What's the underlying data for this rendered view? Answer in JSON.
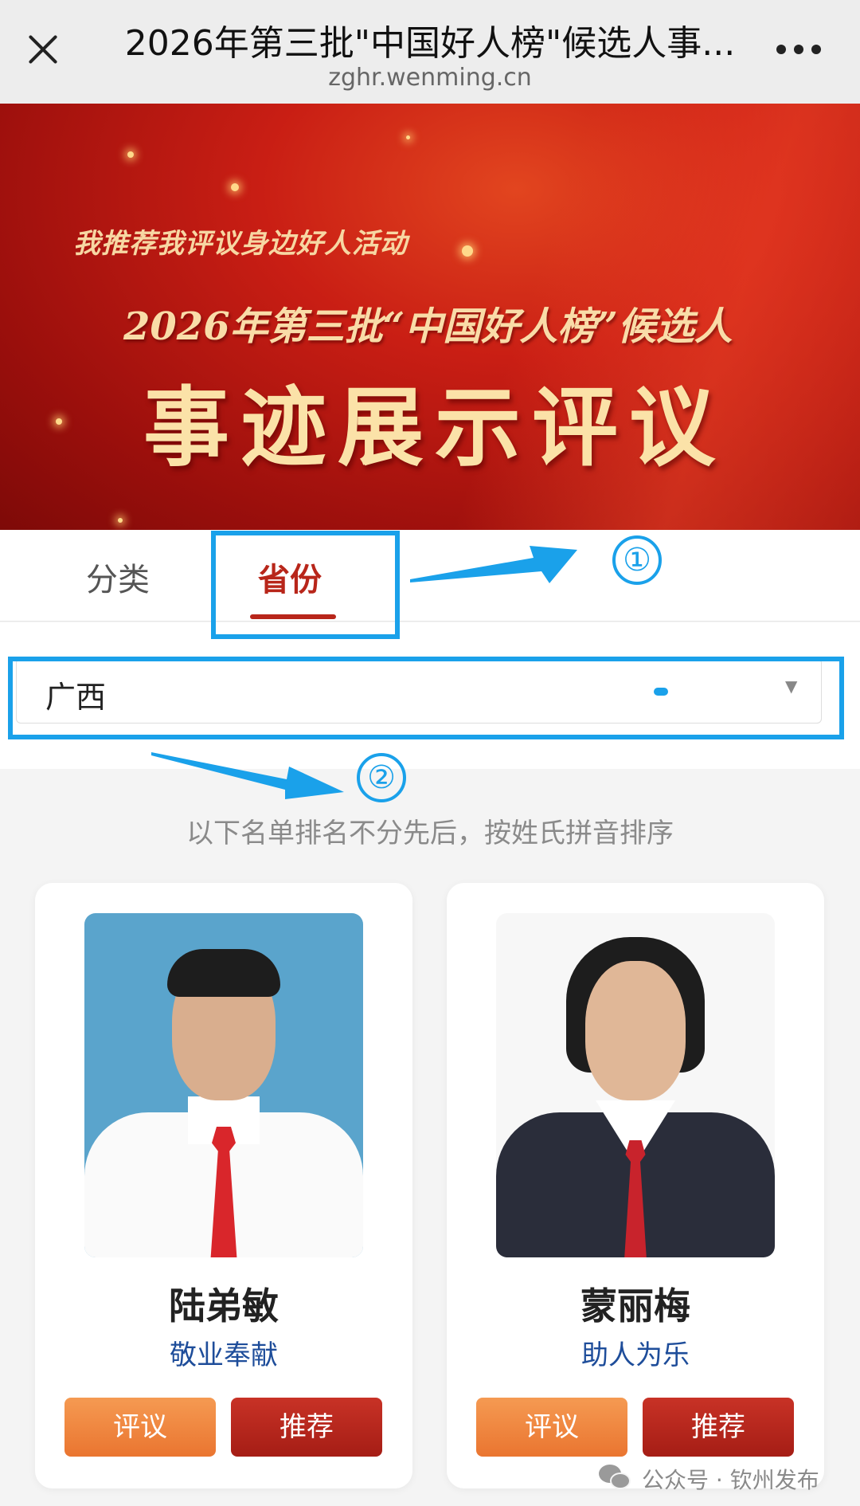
{
  "header": {
    "title": "2026年第三批\"中国好人榜\"候选人事...",
    "domain": "zghr.wenming.cn"
  },
  "banner": {
    "subtitle": "我推荐我评议身边好人活动",
    "line2": "2026年第三批“中国好人榜”候选人",
    "main": "事迹展示评议"
  },
  "tabs": [
    {
      "label": "分类",
      "active": false
    },
    {
      "label": "省份",
      "active": true
    }
  ],
  "province_select": {
    "value": "广西"
  },
  "annotations": {
    "marker_1": "①",
    "marker_2": "②",
    "color": "#1aa1ea"
  },
  "note": "以下名单排名不分先后，按姓氏拼音排序",
  "candidates": [
    {
      "name": "陆弟敏",
      "category": "敬业奉献",
      "comment_label": "评议",
      "recommend_label": "推荐"
    },
    {
      "name": "蒙丽梅",
      "category": "助人为乐",
      "comment_label": "评议",
      "recommend_label": "推荐"
    }
  ],
  "watermark": "公众号 · 钦州发布",
  "colors": {
    "accent_red": "#b8261a",
    "category_blue": "#1e4d9a",
    "comment_orange": "#ea7530",
    "recommend_red": "#a51d15"
  }
}
